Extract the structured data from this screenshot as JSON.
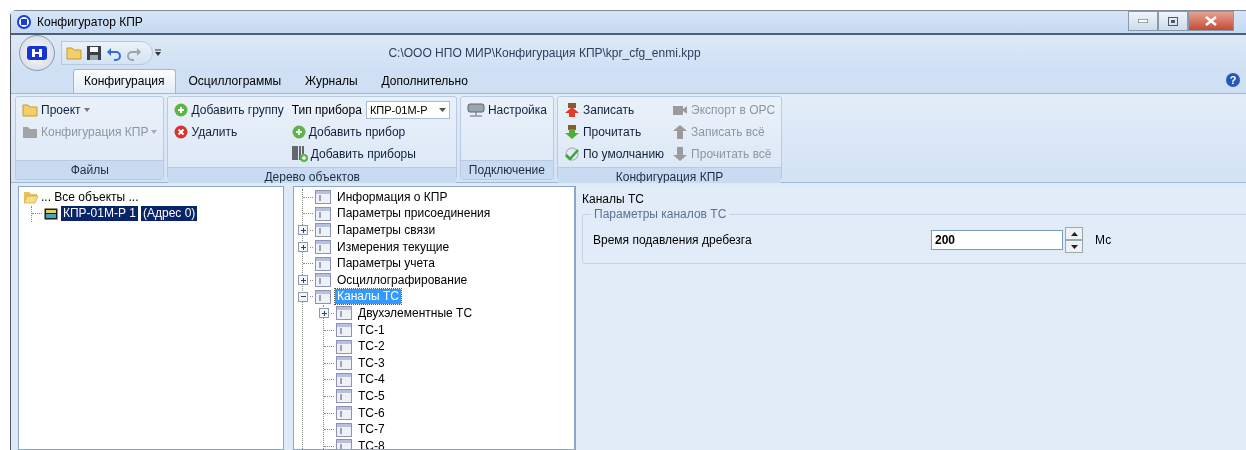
{
  "window": {
    "title": "Конфигуратор КПР",
    "path": "C:\\ООО НПО МИР\\Конфигурация КПР\\kpr_cfg_enmi.kpp"
  },
  "tabs": [
    {
      "label": "Конфигурация",
      "selected": true
    },
    {
      "label": "Осциллограммы",
      "selected": false
    },
    {
      "label": "Журналы",
      "selected": false
    },
    {
      "label": "Дополнительно",
      "selected": false
    }
  ],
  "help": "?",
  "ribbon": {
    "groups": [
      {
        "label": "Файлы",
        "columns": [
          [
            {
              "kind": "dropdown",
              "label": "Проект",
              "disabled": false
            },
            {
              "kind": "dropdown",
              "label": "Конфигурация КПР",
              "disabled": true
            }
          ]
        ]
      },
      {
        "label": "Дерево объектов",
        "columns": [
          [
            {
              "kind": "button",
              "label": "Добавить группу",
              "disabled": false
            },
            {
              "kind": "button",
              "label": "Удалить",
              "disabled": false
            }
          ],
          [
            {
              "kind": "combo",
              "label": "Тип прибора",
              "value": "КПР-01М-Р"
            },
            {
              "kind": "button",
              "label": "Добавить прибор",
              "disabled": false
            },
            {
              "kind": "button",
              "label": "Добавить приборы",
              "disabled": false
            }
          ]
        ]
      },
      {
        "label": "Подключение",
        "columns": [
          [
            {
              "kind": "button",
              "label": "Настройка",
              "disabled": false
            }
          ]
        ]
      },
      {
        "label": "Конфигурация КПР",
        "columns": [
          [
            {
              "kind": "button",
              "label": "Записать",
              "disabled": false
            },
            {
              "kind": "button",
              "label": "Прочитать",
              "disabled": false
            },
            {
              "kind": "button",
              "label": "По умолчанию",
              "disabled": false
            }
          ],
          [
            {
              "kind": "button",
              "label": "Экспорт в ОРС",
              "disabled": true
            },
            {
              "kind": "button",
              "label": "Записать всё",
              "disabled": true
            },
            {
              "kind": "button",
              "label": "Прочитать всё",
              "disabled": true
            }
          ]
        ]
      }
    ]
  },
  "object_tree": {
    "root": {
      "label": "... Все объекты ...",
      "expanded": true,
      "children": [
        {
          "label": "КПР-01М-Р 1",
          "address": "(Адрес 0)",
          "selected": true
        }
      ]
    }
  },
  "settings_tree": {
    "items": [
      {
        "label": "Информация о КПР",
        "selected": false
      },
      {
        "label": "Параметры присоединения",
        "selected": false
      },
      {
        "label": "Параметры связи",
        "selected": false,
        "expanded": false
      },
      {
        "label": "Измерения текущие",
        "selected": false,
        "expanded": false
      },
      {
        "label": "Параметры учета",
        "selected": false
      },
      {
        "label": "Осциллографирование",
        "selected": false,
        "expanded": false
      },
      {
        "label": "Каналы ТС",
        "selected": true,
        "expanded": true,
        "children": [
          {
            "label": "Двухэлементные ТС",
            "selected": false,
            "expanded": false
          },
          {
            "label": "ТС-1",
            "selected": false
          },
          {
            "label": "ТС-2",
            "selected": false
          },
          {
            "label": "ТС-3",
            "selected": false
          },
          {
            "label": "ТС-4",
            "selected": false
          },
          {
            "label": "ТС-5",
            "selected": false
          },
          {
            "label": "ТС-6",
            "selected": false
          },
          {
            "label": "ТС-7",
            "selected": false
          },
          {
            "label": "ТС-8",
            "selected": false
          }
        ]
      }
    ]
  },
  "details": {
    "title": "Каналы ТС",
    "group": {
      "title": "Параметры каналов ТС",
      "fields": [
        {
          "label": "Время подавления дребезга",
          "value": "200",
          "unit": "Мс"
        }
      ]
    }
  }
}
